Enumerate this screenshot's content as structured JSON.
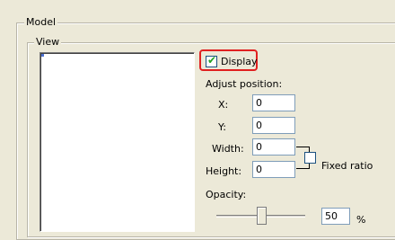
{
  "model": {
    "title": "Model"
  },
  "view": {
    "title": "View",
    "display": {
      "label": "Display",
      "checked": true
    },
    "adjust_position": {
      "label": "Adjust position:",
      "x": {
        "label": "X:",
        "value": "0"
      },
      "y": {
        "label": "Y:",
        "value": "0"
      },
      "width": {
        "label": "Width:",
        "value": "0"
      },
      "height": {
        "label": "Height:",
        "value": "0"
      },
      "fixed_ratio": {
        "label": "Fixed ratio",
        "checked": false
      }
    },
    "opacity": {
      "label": "Opacity:",
      "value": "50",
      "unit": "%",
      "level_percent": 50
    }
  },
  "colors": {
    "highlight": "#e02020",
    "input_border": "#7f9db9"
  }
}
